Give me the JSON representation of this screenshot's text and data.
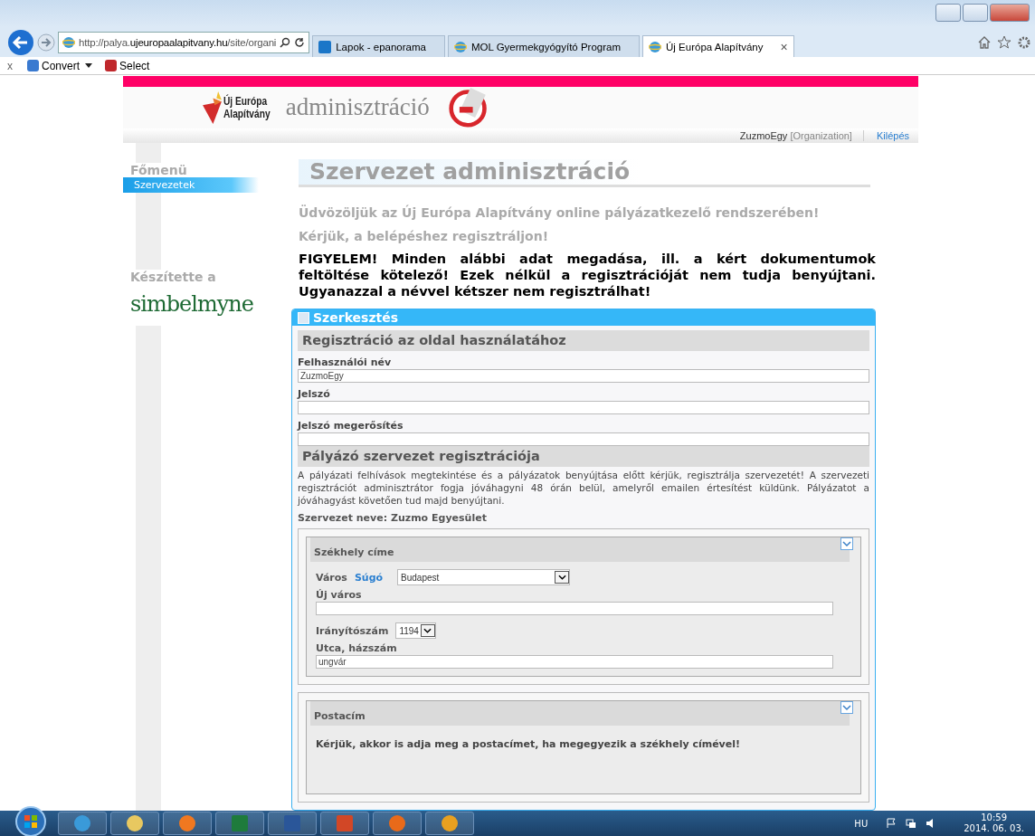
{
  "browser": {
    "close_mark": "x",
    "address": "http://palya.**ujeuropaalapitvany.hu**/site/organi",
    "tabs": [
      {
        "label": "Lapok - epanorama",
        "selected": false,
        "kind": "sp"
      },
      {
        "label": "MOL Gyermekgyógyító Program",
        "selected": false,
        "kind": "ie"
      },
      {
        "label": "Új Európa Alapítvány",
        "selected": true,
        "kind": "ie",
        "close": "×"
      }
    ],
    "toolbar": [
      {
        "label": "Convert",
        "kind": "dropdown"
      },
      {
        "label": "Select",
        "kind": "plain"
      }
    ]
  },
  "header": {
    "logo_line1": "Új Európa",
    "logo_line2": "Alapítvány",
    "title": "adminisztráció",
    "user": "ZuzmoEgy",
    "role": "[Organization]",
    "logout": "Kilépés"
  },
  "sidebar": {
    "menu_title": "Főmenü",
    "items": [
      {
        "label": "Szervezetek",
        "selected": true
      }
    ],
    "credit_title": "Készítette a",
    "credit_logo": "simbelmyne"
  },
  "main": {
    "title": "Szervezet adminisztráció",
    "welcome": "Üdvözöljük az Új Európa Alapítvány online pályázatkezelő rendszerében!",
    "prompt": "Kérjük, a belépéshez regisztráljon!",
    "warning": "FIGYELEM! Minden alábbi adat megadása, ill. a kért dokumentumok feltöltése kötelező! Ezek nélkül a regisztrációját nem tudja benyújtani. Ugyanazzal a névvel kétszer nem regisztrálhat!",
    "panel": {
      "title": "Szerkesztés",
      "section1": "Regisztráció az oldal használatához",
      "fields": [
        {
          "label": "Felhasználói név",
          "value": "ZuzmoEgy"
        },
        {
          "label": "Jelszó"
        },
        {
          "label": "Jelszó megerősítés"
        }
      ],
      "section2": "Pályázó szervezet regisztrációja",
      "intro": "A pályázati felhívások megtekintése és a pályázatok benyújtása előtt kérjük, regisztrálja szervezetét! A szervezeti regisztrációt adminisztrátor fogja jóváhagyni 48 órán belül, amelyről emailen értesítést küldünk. Pályázatot a jóváhagyást követően tud majd benyújtani.",
      "org_name": "Szervezet neve: Zuzmo Egyesület",
      "seat": {
        "title": "Székhely címe",
        "city_label": "Város",
        "help": "Súgó",
        "city": "Budapest",
        "new_city_label": "Új város",
        "zip_label": "Irányítószám",
        "zip": "1194",
        "street_label": "Utca, házszám",
        "street": "ungvár"
      },
      "postal": {
        "title": "Postacím",
        "note": "Kérjük, akkor is adja meg a postacímet, ha megegyezik a székhely címével!"
      }
    }
  },
  "taskbar": {
    "apps": [
      {
        "kind": "ie"
      },
      {
        "kind": "folder"
      },
      {
        "kind": "media"
      },
      {
        "kind": "excel"
      },
      {
        "kind": "word"
      },
      {
        "kind": "powerpoint"
      },
      {
        "kind": "firefox"
      },
      {
        "kind": "outlook"
      }
    ],
    "lang": "HU",
    "time": "10:59",
    "date": "2014. 06. 03."
  }
}
